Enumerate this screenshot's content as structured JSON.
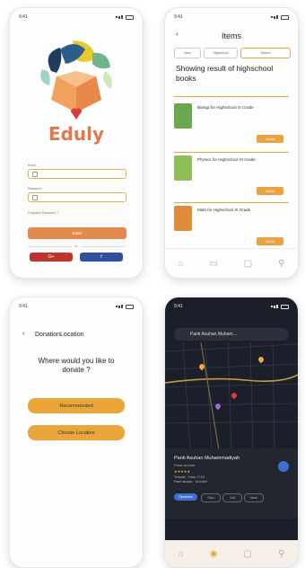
{
  "status": {
    "time": "9:41"
  },
  "login": {
    "brand": "Eduly",
    "email_label": "Email",
    "password_label": "Password",
    "forgot": "Forgotten Password ?",
    "signin": "Enter",
    "or": "or",
    "google": "G+",
    "facebook": "f"
  },
  "items": {
    "back": "‹",
    "title": "Items",
    "chips": [
      "New",
      "Highschool",
      "Search"
    ],
    "showing": "Showing result of highschool books",
    "books": [
      {
        "title": "Biologi for Highschool XI Grade",
        "cover": "#6aa84f"
      },
      {
        "title": "Physics for Highschool XI Grade",
        "cover": "#8fbf5a"
      },
      {
        "title": "Math for Highschool XI Grade",
        "cover": "#e08b3a"
      }
    ],
    "detail_label": "Details",
    "nav": [
      "⌂",
      "▭",
      "▢",
      "⚲"
    ]
  },
  "donation": {
    "back": "‹",
    "title": "DonationLocation",
    "question": "Where would you like to donate ?",
    "recommended": "Recommended",
    "choose": "Choose Location"
  },
  "map": {
    "search_text": "Panti Asuhan Muham…",
    "place_name": "Panti Asuhan Muhammadiyah",
    "place_type": "Panti asuhan",
    "rating": "★★★★★",
    "info": "Terbuka · Tutup 17.00\nPanti asuhan · 15 menit",
    "directions": "Directions",
    "start": "Start",
    "call": "Call",
    "save": "Save",
    "colors": {
      "accent": "#3d6fd4",
      "pin": "#e53935"
    }
  },
  "colors": {
    "brand": "#e07a4c",
    "accent": "#eba23f",
    "google": "#c0332e",
    "facebook": "#2f4fa0"
  }
}
